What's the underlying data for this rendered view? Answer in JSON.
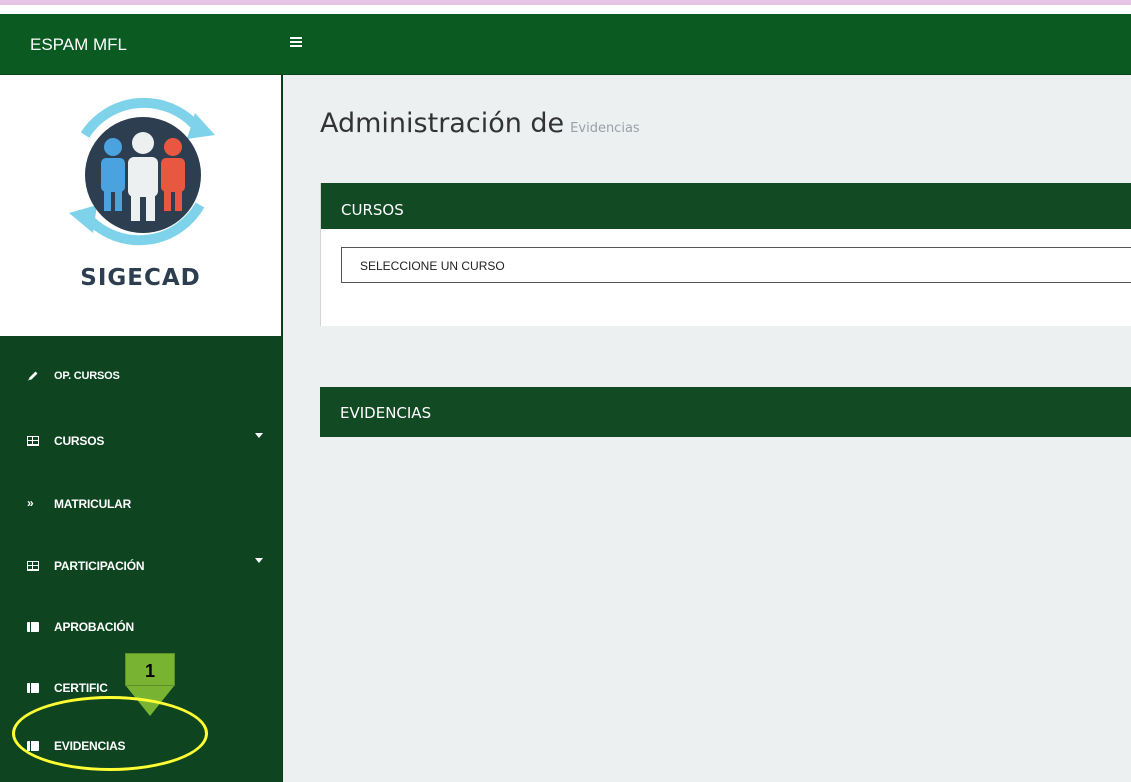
{
  "app": {
    "brand": "ESPAM MFL",
    "logo_text": "SIGECAD"
  },
  "header": {
    "menu_icon": "hamburger-icon"
  },
  "sidebar": {
    "items": [
      {
        "label": "OP. CURSOS",
        "icon": "pencil-icon"
      },
      {
        "label": "CURSOS",
        "icon": "table-icon",
        "has_submenu": true
      },
      {
        "label": "MATRICULAR",
        "icon": "double-chevron-icon"
      },
      {
        "label": "PARTICIPACIÓN",
        "icon": "table-icon",
        "has_submenu": true
      },
      {
        "label": "APROBACIÓN",
        "icon": "list-icon"
      },
      {
        "label": "CERTIFIC",
        "icon": "list-icon"
      },
      {
        "label": "EVIDENCIAS",
        "icon": "list-icon"
      }
    ]
  },
  "annotation": {
    "step_number": "1",
    "highlight_color": "#ffff33",
    "callout_color": "#78b432"
  },
  "main": {
    "title": "Administración de",
    "subtitle": "Evidencias",
    "cursos_panel": {
      "header": "CURSOS",
      "select_value": "SELECCIONE UN CURSO"
    },
    "evidencias_panel": {
      "header": "EVIDENCIAS"
    }
  },
  "colors": {
    "navbar": "#0b5a22",
    "sidebar": "#0e4420",
    "panel_header": "#114a23",
    "background": "#ecf0f1"
  }
}
